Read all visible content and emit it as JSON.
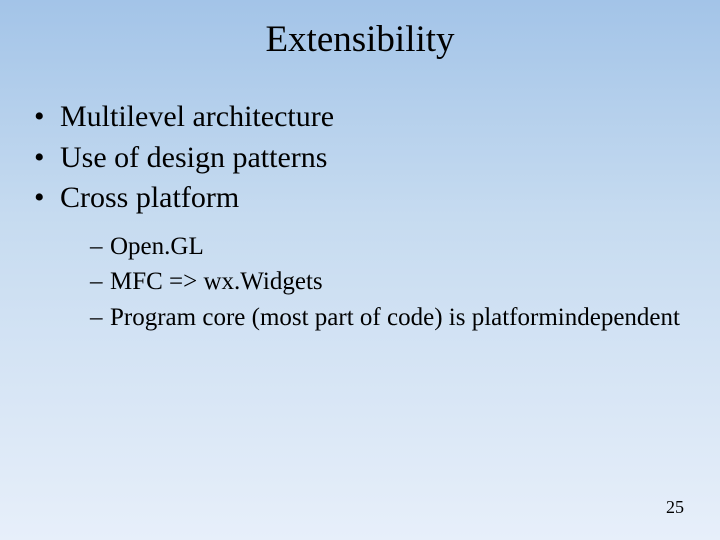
{
  "title": "Extensibility",
  "bullets": {
    "b0": "Multilevel architecture",
    "b1": "Use of design patterns",
    "b2": "Cross platform"
  },
  "sub": {
    "s0": "Open.GL",
    "s1": "MFC => wx.Widgets",
    "s2": "Program core (most part of code) is platform­independent"
  },
  "page": "25"
}
